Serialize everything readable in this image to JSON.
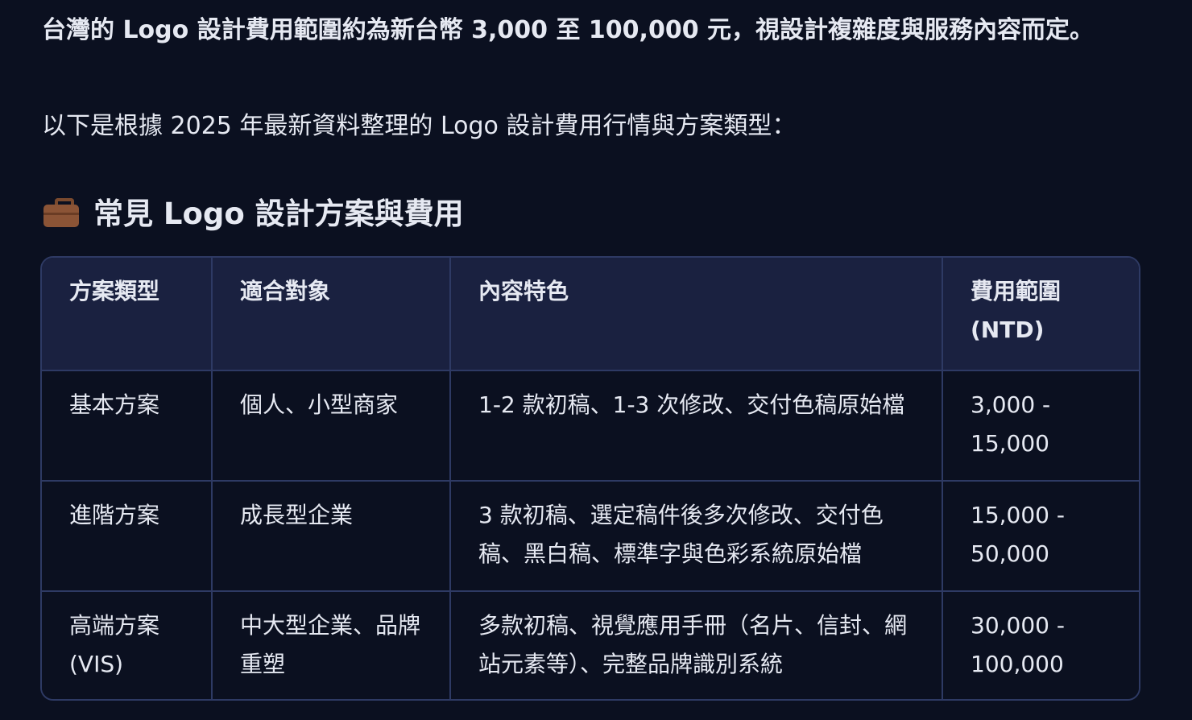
{
  "intro": {
    "line1": "台灣的 Logo 設計費用範圍約為新台幣 3,000 至 100,000 元，視設計複雜度與服務內容而定。",
    "line2": "以下是根據 2025 年最新資料整理的 Logo 設計費用行情與方案類型："
  },
  "section": {
    "icon": "briefcase-icon",
    "title": "常見 Logo 設計方案與費用"
  },
  "table": {
    "headers": [
      "方案類型",
      "適合對象",
      "內容特色",
      "費用範圍 (NTD)"
    ],
    "rows": [
      [
        "基本方案",
        "個人、小型商家",
        "1-2 款初稿、1-3 次修改、交付色稿原始檔",
        "3,000 - 15,000"
      ],
      [
        "進階方案",
        "成長型企業",
        "3 款初稿、選定稿件後多次修改、交付色稿、黑白稿、標準字與色彩系統原始檔",
        "15,000 - 50,000"
      ],
      [
        "高端方案 (VIS)",
        "中大型企業、品牌重塑",
        "多款初稿、視覺應用手冊（名片、信封、網站元素等）、完整品牌識別系統",
        "30,000 - 100,000"
      ]
    ]
  }
}
